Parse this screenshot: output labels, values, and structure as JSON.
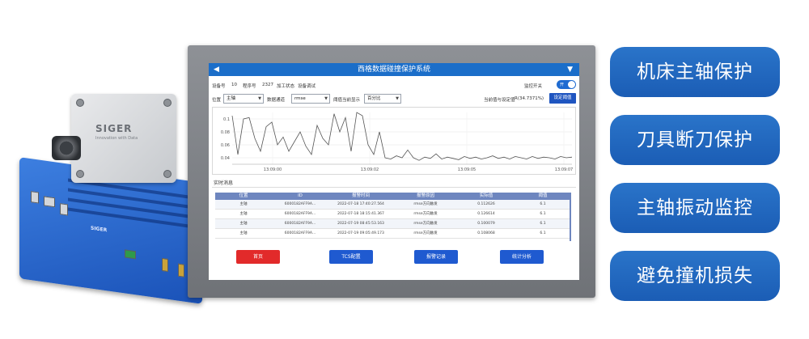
{
  "hardware": {
    "sensor_brand": "SIGER",
    "sensor_slogan": "Innovation with Data",
    "box_label": "SIGER"
  },
  "screen": {
    "title": "西格数据碰撞保护系统",
    "nav_back_icon": "◀",
    "nav_menu_icon": "▼",
    "row1": {
      "device_label": "设备号",
      "device_value": "10",
      "program_label": "程序号",
      "program_value": "2327",
      "state_label": "加工状态",
      "state_value": "设备调试",
      "monitor_switch_label": "监控开关",
      "toggle_text": "开"
    },
    "row2": {
      "position_label": "位置",
      "position_value": "主轴",
      "channel_label": "数据通道",
      "channel_value": "rmse",
      "threshold_label": "阈值当前显示",
      "threshold_value": "百分比",
      "ratio_label": "当前值与设定值",
      "ratio_value": "R(34.7371%)",
      "set_button": "设定阈值"
    },
    "realtime_title": "实时消息",
    "table": {
      "headers": [
        "位置",
        "ID",
        "报警时间",
        "报警原因",
        "实际值",
        "阈值"
      ],
      "rows": [
        [
          "主轴",
          "6000182AFF9A...",
          "2022-07-18 17:40:27.564",
          "rmse方向触发",
          "0.112626",
          "6.1"
        ],
        [
          "主轴",
          "6000182AFF9A...",
          "2022-07-18 18:15:41.367",
          "rmse方向触发",
          "0.126614",
          "6.1"
        ],
        [
          "主轴",
          "6000182AFF9A...",
          "2022-07-19 08:45:53.163",
          "rmse方向触发",
          "0.100079",
          "6.1"
        ],
        [
          "主轴",
          "6000182AFF9A...",
          "2022-07-19 09:05:49.173",
          "rmse方向触发",
          "0.108068",
          "6.1"
        ]
      ]
    },
    "buttons": {
      "home": "首页",
      "tcs": "TCS配置",
      "alarm": "报警记录",
      "stats": "统计分析"
    }
  },
  "chart_data": {
    "type": "line",
    "x_ticks": [
      "13:09:00",
      "13:09:02",
      "13:09:05",
      "13:09:07"
    ],
    "y_ticks": [
      "0.1",
      "0.08",
      "0.06",
      "0.04"
    ],
    "ylim": [
      0.03,
      0.11
    ],
    "x": [
      0,
      1,
      2,
      3,
      4,
      5,
      6,
      7,
      8,
      9,
      10,
      11,
      12,
      13,
      14,
      15,
      16,
      17,
      18,
      19,
      20,
      21,
      22,
      23,
      24,
      25,
      26,
      27,
      28,
      29,
      30,
      31,
      32,
      33,
      34,
      35,
      36,
      37,
      38,
      39,
      40,
      41,
      42,
      43,
      44,
      45,
      46,
      47,
      48,
      49,
      50,
      51,
      52,
      53,
      54,
      55,
      56,
      57,
      58,
      59,
      60
    ],
    "series": [
      {
        "color": "#555555",
        "values": [
          0.105,
          0.045,
          0.1,
          0.102,
          0.07,
          0.05,
          0.088,
          0.095,
          0.06,
          0.072,
          0.05,
          0.065,
          0.08,
          0.058,
          0.045,
          0.09,
          0.07,
          0.06,
          0.108,
          0.08,
          0.102,
          0.05,
          0.11,
          0.105,
          0.06,
          0.045,
          0.08,
          0.04,
          0.038,
          0.043,
          0.04,
          0.052,
          0.04,
          0.036,
          0.041,
          0.039,
          0.046,
          0.038,
          0.041,
          0.039,
          0.037,
          0.042,
          0.039,
          0.041,
          0.038,
          0.04,
          0.043,
          0.039,
          0.041,
          0.038,
          0.042,
          0.04,
          0.038,
          0.042,
          0.039,
          0.041,
          0.04,
          0.038,
          0.042,
          0.04,
          0.041
        ]
      }
    ]
  },
  "features": [
    "机床主轴保护",
    "刀具断刀保护",
    "主轴振动监控",
    "避免撞机损失"
  ]
}
